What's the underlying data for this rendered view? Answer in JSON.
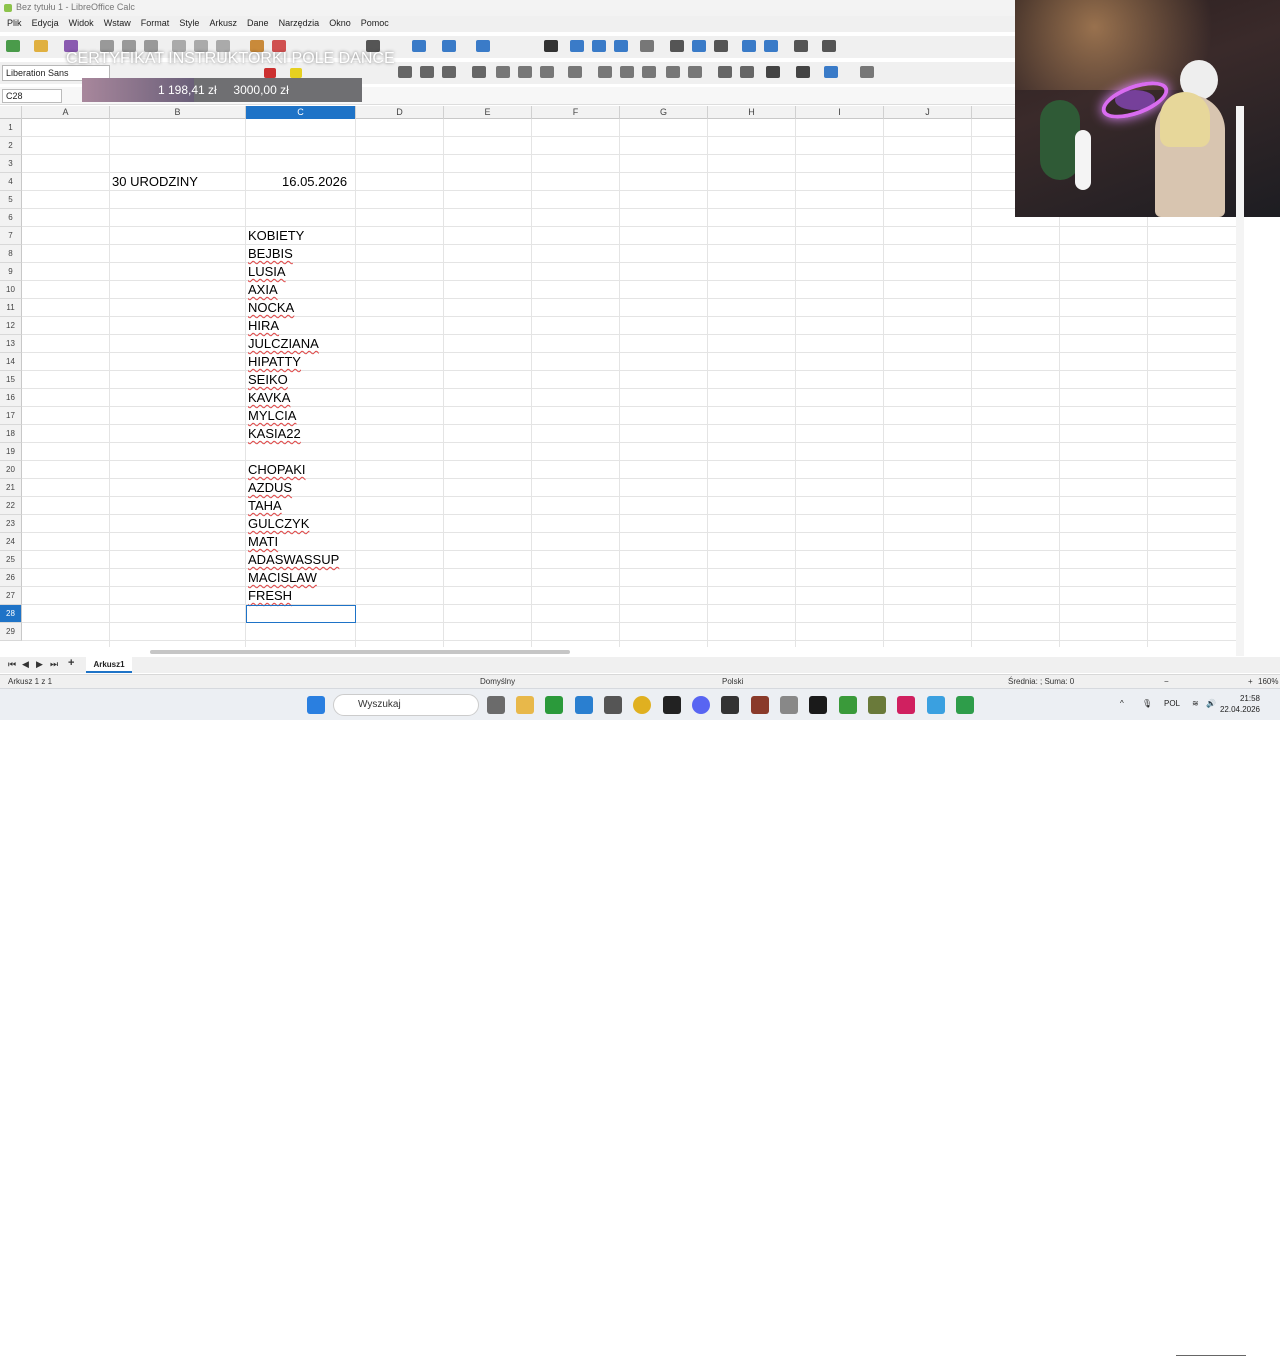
{
  "window": {
    "title": "Bez tytułu 1 - LibreOffice Calc"
  },
  "menu": [
    "Plik",
    "Edycja",
    "Widok",
    "Wstaw",
    "Format",
    "Style",
    "Arkusz",
    "Dane",
    "Narzędzia",
    "Okno",
    "Pomoc"
  ],
  "toolbar": {
    "font_name": "Liberation Sans"
  },
  "formula": {
    "cell_ref": "C28",
    "content": ""
  },
  "overlay": {
    "title": "CERTYFIKAT INSTRUKTORKI POLE DANCE",
    "current": "1 198,41 zł",
    "goal": "3000,00 zł",
    "progress_fraction": 0.4
  },
  "columns": [
    "A",
    "B",
    "C",
    "D",
    "E",
    "F",
    "G",
    "H",
    "I",
    "J"
  ],
  "active_column": "C",
  "rows": [
    "1",
    "2",
    "3",
    "4",
    "5",
    "6",
    "7",
    "8",
    "9",
    "10",
    "11",
    "12",
    "13",
    "14",
    "15",
    "16",
    "17",
    "18",
    "19",
    "20",
    "21",
    "22",
    "23",
    "24",
    "25",
    "26",
    "27",
    "28",
    "29"
  ],
  "active_row": "28",
  "cells": {
    "b4": "30 URODZINY",
    "c4": "16.05.2026",
    "c7": "KOBIETY",
    "names": [
      "BEJBIS",
      "LUSIA",
      "AXIA",
      "NOCKA",
      "HIRA",
      "JULCZIANA",
      "HIPATTY",
      "SEIKO",
      "KAVKA",
      "MYLCIA",
      "KASIA22",
      "",
      "CHOPAKI",
      "AZDUS",
      "TAHA",
      "GULCZYK",
      "MATI",
      "ADASWASSUP",
      "MACISLAW",
      "FRESH"
    ]
  },
  "sheet_tab": "Arkusz1",
  "status": {
    "sheet_pos": "Arkusz 1 z 1",
    "style": "Domyślny",
    "language": "Polski",
    "summary": "Średnia: ; Suma: 0",
    "zoom": "160%"
  },
  "taskbar": {
    "search_placeholder": "Wyszukaj",
    "lang": "POL",
    "time": "21:58",
    "date": "22.04.2026"
  },
  "colors": {
    "accent": "#1e73c7",
    "calc_green": "#8cc34b"
  }
}
